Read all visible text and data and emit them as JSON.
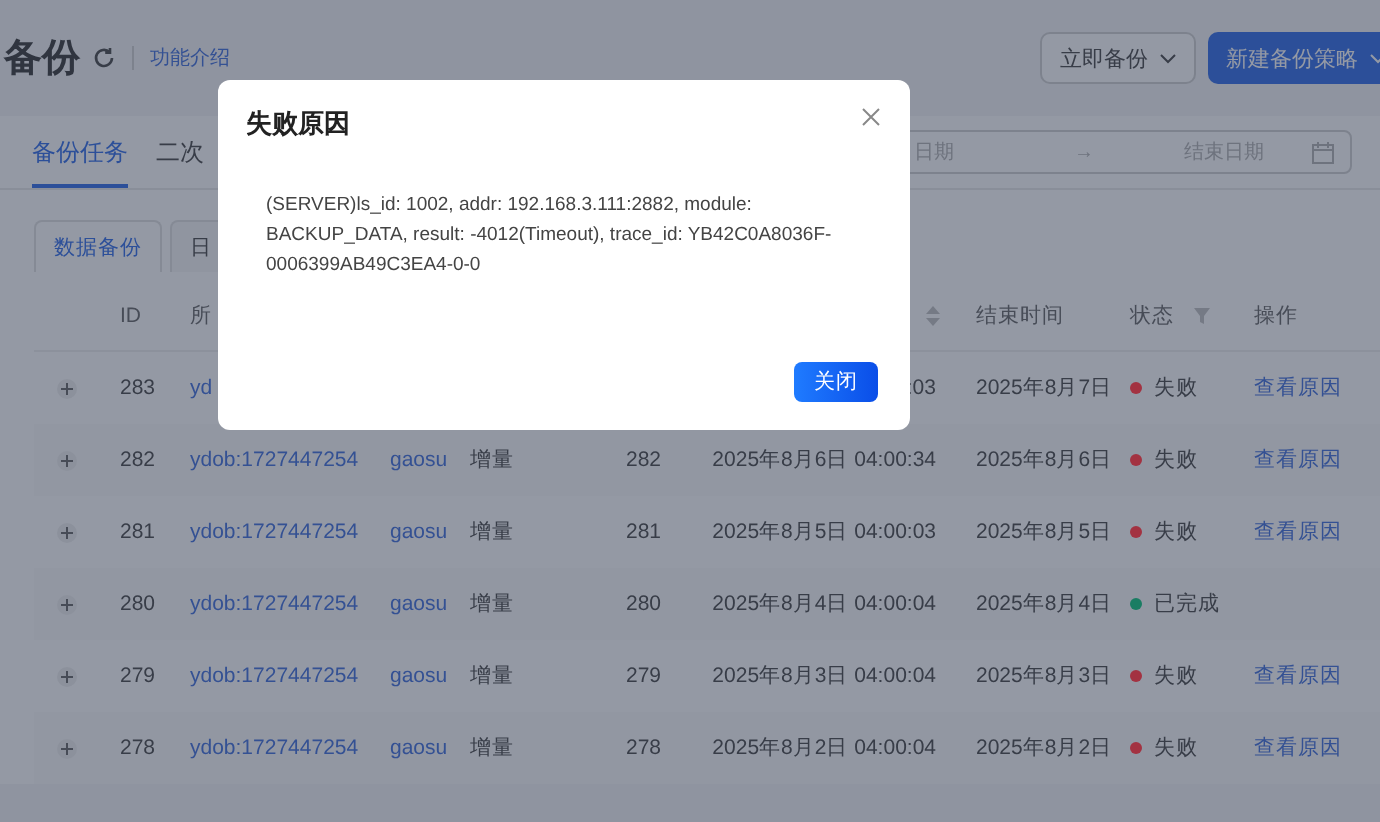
{
  "page": {
    "title": "备份",
    "intro_link": "功能介绍",
    "buttons": [
      {
        "label": "立即备份",
        "kind": "default"
      },
      {
        "label": "新建备份策略",
        "kind": "primary"
      }
    ]
  },
  "tabs": [
    {
      "label": "备份任务",
      "selected": true
    },
    {
      "label": "二次",
      "selected": false
    }
  ],
  "date_range": {
    "start_placeholder": "日期",
    "separator": "→",
    "end_placeholder": "结束日期"
  },
  "subtabs": [
    {
      "label": "数据备份",
      "selected": true
    },
    {
      "label": "日",
      "selected": false
    }
  ],
  "table": {
    "columns": [
      {
        "kind": "expand"
      },
      {
        "kind": "text",
        "label": "ID"
      },
      {
        "kind": "text",
        "label": "所"
      },
      {
        "kind": "covered"
      },
      {
        "kind": "covered"
      },
      {
        "kind": "covered"
      },
      {
        "kind": "sort"
      },
      {
        "kind": "text",
        "label": "结束时间"
      },
      {
        "kind": "filter",
        "label": "状态"
      },
      {
        "kind": "text",
        "label": "操作"
      }
    ],
    "rows": [
      {
        "id": "283",
        "project": "yd",
        "start_time": ":03",
        "end_time": "2025年8月7日",
        "status": {
          "label": "失败",
          "color": "#a33241"
        },
        "action": "查看原因"
      },
      {
        "id": "282",
        "project": "ydob:1727447254",
        "user": "gaosu",
        "type": "增量",
        "column_6": "282",
        "start_time": "2025年8月6日 04:00:34",
        "end_time": "2025年8月6日",
        "status": {
          "label": "失败",
          "color": "#a33241"
        },
        "action": "查看原因"
      },
      {
        "id": "281",
        "project": "ydob:1727447254",
        "user": "gaosu",
        "type": "增量",
        "column_6": "281",
        "start_time": "2025年8月5日 04:00:03",
        "end_time": "2025年8月5日",
        "status": {
          "label": "失败",
          "color": "#a33241"
        },
        "action": "查看原因"
      },
      {
        "id": "280",
        "project": "ydob:1727447254",
        "user": "gaosu",
        "type": "增量",
        "column_6": "280",
        "start_time": "2025年8月4日 04:00:04",
        "end_time": "2025年8月4日",
        "status": {
          "label": "已完成",
          "color": "#1a7d63"
        }
      },
      {
        "id": "279",
        "project": "ydob:1727447254",
        "user": "gaosu",
        "type": "增量",
        "column_6": "279",
        "start_time": "2025年8月3日 04:00:04",
        "end_time": "2025年8月3日",
        "status": {
          "label": "失败",
          "color": "#a33241"
        },
        "action": "查看原因"
      },
      {
        "id": "278",
        "project": "ydob:1727447254",
        "user": "gaosu",
        "type": "增量",
        "column_6": "278",
        "start_time": "2025年8月2日 04:00:04",
        "end_time": "2025年8月2日",
        "status": {
          "label": "失败",
          "color": "#a33241"
        },
        "action": "查看原因"
      }
    ]
  },
  "dialog": {
    "title": "失败原因",
    "message": "(SERVER)ls_id: 1002, addr: 192.168.3.111:2882, module: BACKUP_DATA, result: -4012(Timeout), trace_id: YB42C0A8036F-0006399AB49C3EA4-0-0",
    "button": "关闭"
  }
}
